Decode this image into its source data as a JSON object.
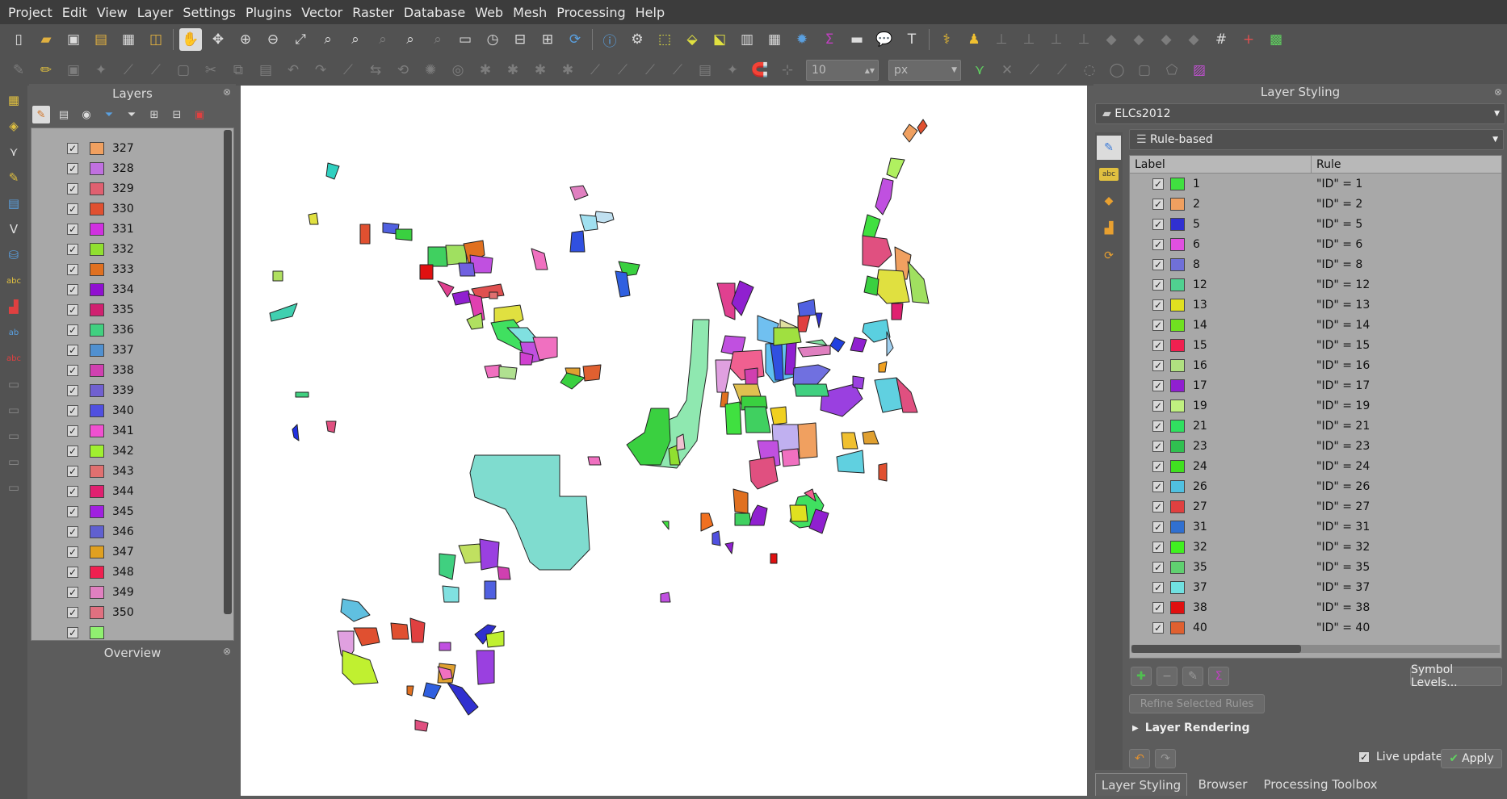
{
  "menu": [
    "Project",
    "Edit",
    "View",
    "Layer",
    "Settings",
    "Plugins",
    "Vector",
    "Raster",
    "Database",
    "Web",
    "Mesh",
    "Processing",
    "Help"
  ],
  "toolbar": {
    "width_value": "10",
    "unit_value": "px"
  },
  "layers_panel": {
    "title": "Layers",
    "items": [
      {
        "label": "327",
        "color": "#f0a060"
      },
      {
        "label": "328",
        "color": "#c070e0"
      },
      {
        "label": "329",
        "color": "#e06070"
      },
      {
        "label": "330",
        "color": "#e05030"
      },
      {
        "label": "331",
        "color": "#d030e0"
      },
      {
        "label": "332",
        "color": "#90e030"
      },
      {
        "label": "333",
        "color": "#e07020"
      },
      {
        "label": "334",
        "color": "#9010d0"
      },
      {
        "label": "335",
        "color": "#d02070"
      },
      {
        "label": "336",
        "color": "#40d080"
      },
      {
        "label": "337",
        "color": "#5090d0"
      },
      {
        "label": "338",
        "color": "#d040b0"
      },
      {
        "label": "339",
        "color": "#7060d0"
      },
      {
        "label": "340",
        "color": "#5050e0"
      },
      {
        "label": "341",
        "color": "#f050d0"
      },
      {
        "label": "342",
        "color": "#a0f030"
      },
      {
        "label": "343",
        "color": "#e07070"
      },
      {
        "label": "344",
        "color": "#e02070"
      },
      {
        "label": "345",
        "color": "#a020e0"
      },
      {
        "label": "346",
        "color": "#6060d0"
      },
      {
        "label": "347",
        "color": "#e0a020"
      },
      {
        "label": "348",
        "color": "#f02050"
      },
      {
        "label": "349",
        "color": "#e080c0"
      },
      {
        "label": "350",
        "color": "#e07080"
      },
      {
        "label": "",
        "color": "#90f070"
      }
    ]
  },
  "overview_title": "Overview",
  "styling_panel": {
    "title": "Layer Styling",
    "layer_name": "ELCs2012",
    "renderer": "Rule-based",
    "columns": {
      "label": "Label",
      "rule": "Rule"
    },
    "rules": [
      {
        "label": "1",
        "rule": "\"ID\" = 1",
        "color": "#40e040"
      },
      {
        "label": "2",
        "rule": "\"ID\" = 2",
        "color": "#f0a060"
      },
      {
        "label": "5",
        "rule": "\"ID\" = 5",
        "color": "#3030d0"
      },
      {
        "label": "6",
        "rule": "\"ID\" = 6",
        "color": "#e050e0"
      },
      {
        "label": "8",
        "rule": "\"ID\" = 8",
        "color": "#7070d8"
      },
      {
        "label": "12",
        "rule": "\"ID\" = 12",
        "color": "#50d090"
      },
      {
        "label": "13",
        "rule": "\"ID\" = 13",
        "color": "#e0e020"
      },
      {
        "label": "14",
        "rule": "\"ID\" = 14",
        "color": "#70e020"
      },
      {
        "label": "15",
        "rule": "\"ID\" = 15",
        "color": "#f02050"
      },
      {
        "label": "16",
        "rule": "\"ID\" = 16",
        "color": "#b0e080"
      },
      {
        "label": "17",
        "rule": "\"ID\" = 17",
        "color": "#9020d0"
      },
      {
        "label": "19",
        "rule": "\"ID\" = 19",
        "color": "#c0f080"
      },
      {
        "label": "21",
        "rule": "\"ID\" = 21",
        "color": "#30e060"
      },
      {
        "label": "23",
        "rule": "\"ID\" = 23",
        "color": "#30c050"
      },
      {
        "label": "24",
        "rule": "\"ID\" = 24",
        "color": "#40e020"
      },
      {
        "label": "26",
        "rule": "\"ID\" = 26",
        "color": "#50c0e0"
      },
      {
        "label": "27",
        "rule": "\"ID\" = 27",
        "color": "#e04040"
      },
      {
        "label": "31",
        "rule": "\"ID\" = 31",
        "color": "#3070d0"
      },
      {
        "label": "32",
        "rule": "\"ID\" = 32",
        "color": "#40f020"
      },
      {
        "label": "35",
        "rule": "\"ID\" = 35",
        "color": "#60d070"
      },
      {
        "label": "37",
        "rule": "\"ID\" = 37",
        "color": "#70e0e0"
      },
      {
        "label": "38",
        "rule": "\"ID\" = 38",
        "color": "#e01010"
      },
      {
        "label": "40",
        "rule": "\"ID\" = 40",
        "color": "#e06030"
      }
    ],
    "symbol_levels": "Symbol Levels...",
    "refine_rules": "Refine Selected Rules",
    "layer_rendering": "Layer Rendering",
    "live_update": "Live update",
    "apply": "Apply"
  },
  "bottom_tabs": [
    "Layer Styling",
    "Browser",
    "Processing Toolbox"
  ]
}
